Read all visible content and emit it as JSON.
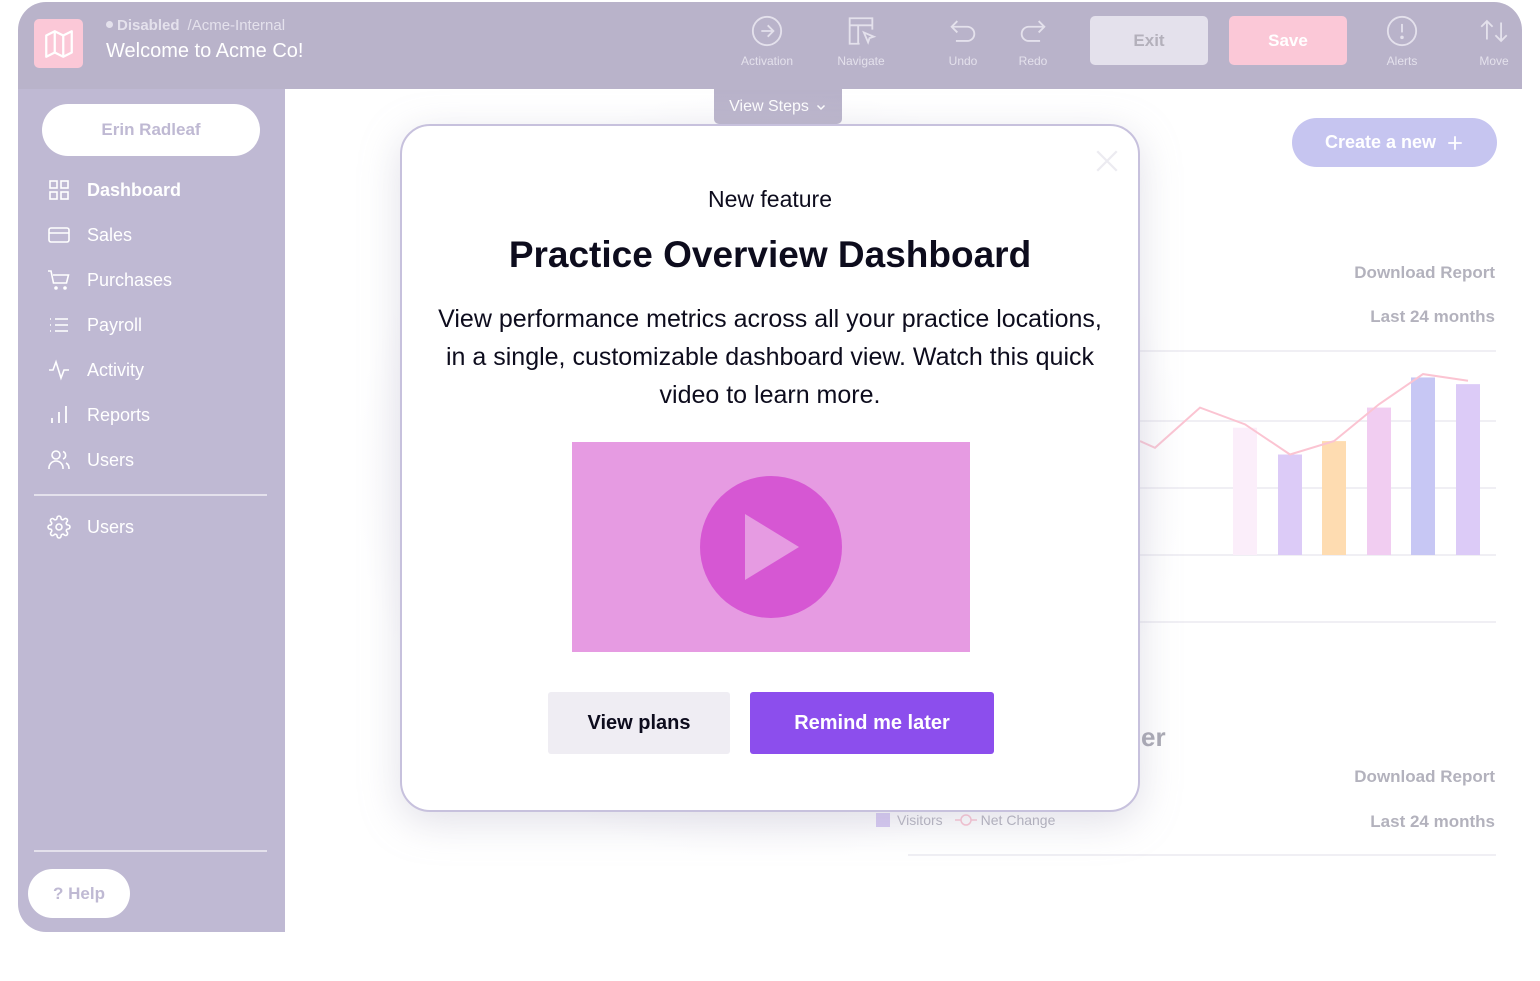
{
  "topbar": {
    "status": "Disabled",
    "path": "/Acme-Internal",
    "title": "Welcome to Acme Co!",
    "tools": [
      {
        "label": "Activation",
        "icon": "arrow-circle-right-icon"
      },
      {
        "label": "Navigate",
        "icon": "layout-pointer-icon"
      },
      {
        "label": "Undo",
        "icon": "undo-icon"
      },
      {
        "label": "Redo",
        "icon": "redo-icon"
      },
      {
        "label": "Alerts",
        "icon": "alert-circle-icon"
      },
      {
        "label": "Move",
        "icon": "arrows-up-down-icon"
      }
    ],
    "exit_label": "Exit",
    "save_label": "Save",
    "view_steps_label": "View Steps",
    "colors": {
      "bar": "#b9b3ca",
      "logo": "#fbc8d7",
      "save": "#fbc8d7",
      "exit": "#e4e1ec"
    }
  },
  "sidebar": {
    "user_name": "Erin Radleaf",
    "items": [
      {
        "label": "Dashboard",
        "icon": "grid-icon",
        "active": true
      },
      {
        "label": "Sales",
        "icon": "credit-card-icon"
      },
      {
        "label": "Purchases",
        "icon": "cart-icon"
      },
      {
        "label": "Payroll",
        "icon": "list-icon"
      },
      {
        "label": "Activity",
        "icon": "activity-icon"
      },
      {
        "label": "Reports",
        "icon": "bar-chart-icon"
      },
      {
        "label": "Users",
        "icon": "users-icon"
      }
    ],
    "settings_item": {
      "label": "Users",
      "icon": "gear-icon"
    },
    "help_label": "? Help",
    "colors": {
      "bg": "#bfb9d3"
    }
  },
  "main": {
    "create_label": "Create a new",
    "card1": {
      "download_label": "Download Report",
      "range_label": "Last 24 months"
    },
    "card2": {
      "title_fragment": "er",
      "download_label": "Download Report",
      "range_label": "Last 24 months"
    },
    "legend": [
      {
        "label": "Visitors"
      },
      {
        "label": "Net Change"
      }
    ]
  },
  "modal": {
    "eyebrow": "New feature",
    "title": "Practice Overview Dashboard",
    "body": "View performance metrics across all your practice locations, in a single, customizable dashboard view. Watch this quick video to learn more.",
    "video_label": "Play video",
    "secondary_label": "View plans",
    "primary_label": "Remind me later",
    "colors": {
      "primary": "#8c4eed",
      "video_bg": "#e69be2",
      "play": "#d657d3",
      "border": "#c7c1dd"
    }
  },
  "chart_data": {
    "type": "bar",
    "title": "",
    "xlabel": "",
    "ylabel": "",
    "ylim": [
      0,
      3
    ],
    "grid": true,
    "legend": "bottom-left",
    "series": [
      {
        "name": "Visitors",
        "kind": "bar",
        "values": [
          1.9,
          1.5,
          1.7,
          2.2,
          2.65,
          2.55
        ],
        "colors": [
          "#fbeefa",
          "#dccbf7",
          "#fedcb1",
          "#f1cdf1",
          "#c7c7f4",
          "#dccbf7"
        ]
      },
      {
        "name": "Net Change",
        "kind": "line",
        "color": "#fbc4d2",
        "values": [
          1.7,
          1.6,
          2.2,
          1.95,
          1.5,
          1.7,
          2.25,
          2.7,
          2.6
        ]
      }
    ]
  }
}
